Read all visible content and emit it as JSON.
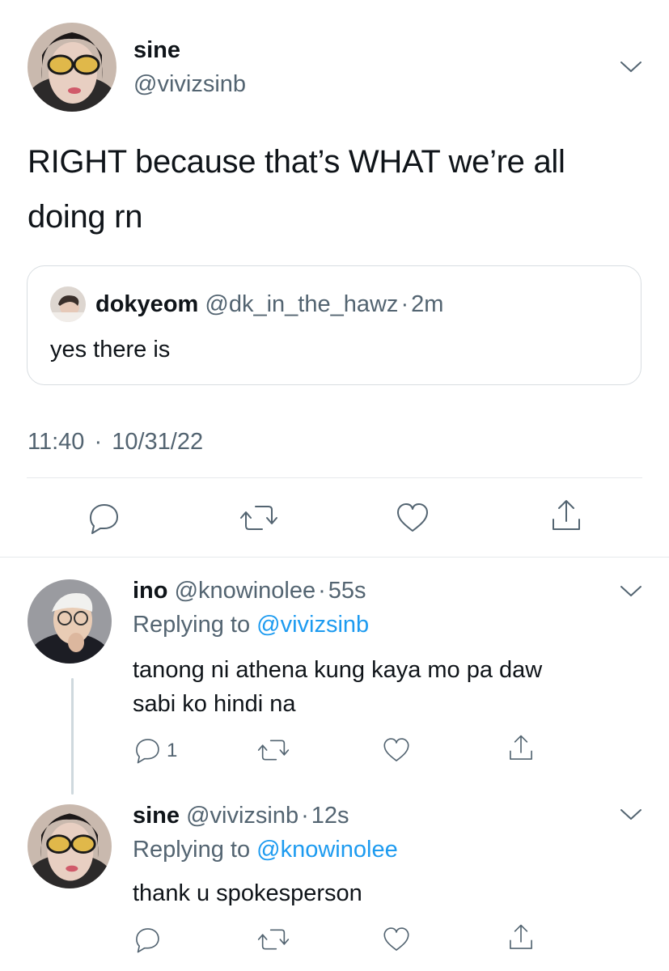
{
  "main_tweet": {
    "display_name": "sine",
    "handle": "@vivizsinb",
    "text_line1": "RIGHT because that’s WHAT we’re all",
    "text_line2": "doing rn",
    "time": "11:40",
    "separator": "·",
    "date": "10/31/22"
  },
  "quoted_tweet": {
    "display_name": "dokyeom",
    "handle": "@dk_in_the_hawz",
    "separator": "·",
    "time": "2m",
    "text": "yes there is"
  },
  "replies": [
    {
      "display_name": "ino",
      "handle": "@knowinolee",
      "separator": "·",
      "time": "55s",
      "replying_prefix": "Replying to",
      "replying_to": "@vivizsinb",
      "text_line1": "tanong ni athena kung kaya mo pa daw",
      "text_line2": "sabi ko hindi na",
      "reply_count": "1"
    },
    {
      "display_name": "sine",
      "handle": "@vivizsinb",
      "separator": "·",
      "time": "12s",
      "replying_prefix": "Replying to",
      "replying_to": "@knowinolee",
      "text_line1": "thank u spokesperson"
    }
  ],
  "icons": {
    "reply": "reply-icon",
    "retweet": "retweet-icon",
    "like": "heart-icon",
    "share": "share-icon",
    "more": "chevron-down-icon"
  },
  "colors": {
    "text": "#0f1419",
    "secondary": "#536471",
    "link": "#1d9bf0",
    "divider": "#e6e9ec"
  }
}
